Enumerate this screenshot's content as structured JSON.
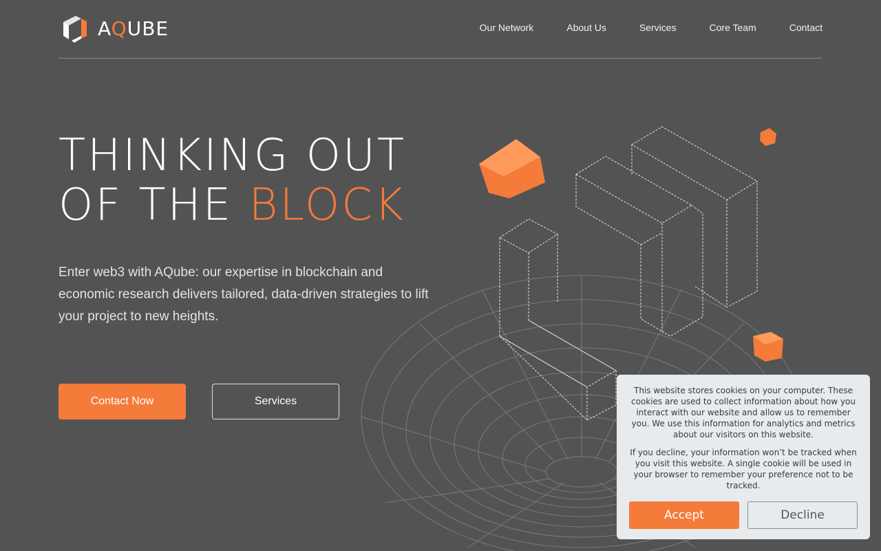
{
  "header": {
    "logo_text_a": "A",
    "logo_text_q": "Q",
    "logo_text_rest": "UBE",
    "nav": [
      "Our Network",
      "About Us",
      "Services",
      "Core Team",
      "Contact"
    ]
  },
  "hero": {
    "title_line1": "THINKING OUT",
    "title_line2_plain": "OF THE ",
    "title_line2_accent": "BLOCK",
    "subtitle": "Enter web3 with AQube: our expertise in blockchain and economic research delivers tailored, data-driven strategies to lift your project to new heights.",
    "primary_button": "Contact Now",
    "secondary_button": "Services"
  },
  "cookie": {
    "text1": "This website stores cookies on your computer. These cookies are used to collect information about how you interact with our website and allow us to remember you. We use this information for analytics and metrics about our visitors on this website.",
    "text2": "If you decline, your information won’t be tracked when you visit this website. A single cookie will be used in your browser to remember your preference not to be tracked.",
    "accept": "Accept",
    "decline": "Decline"
  },
  "colors": {
    "accent": "#f47b3a",
    "background": "#535353",
    "cookie_bg": "#e8ebed"
  }
}
